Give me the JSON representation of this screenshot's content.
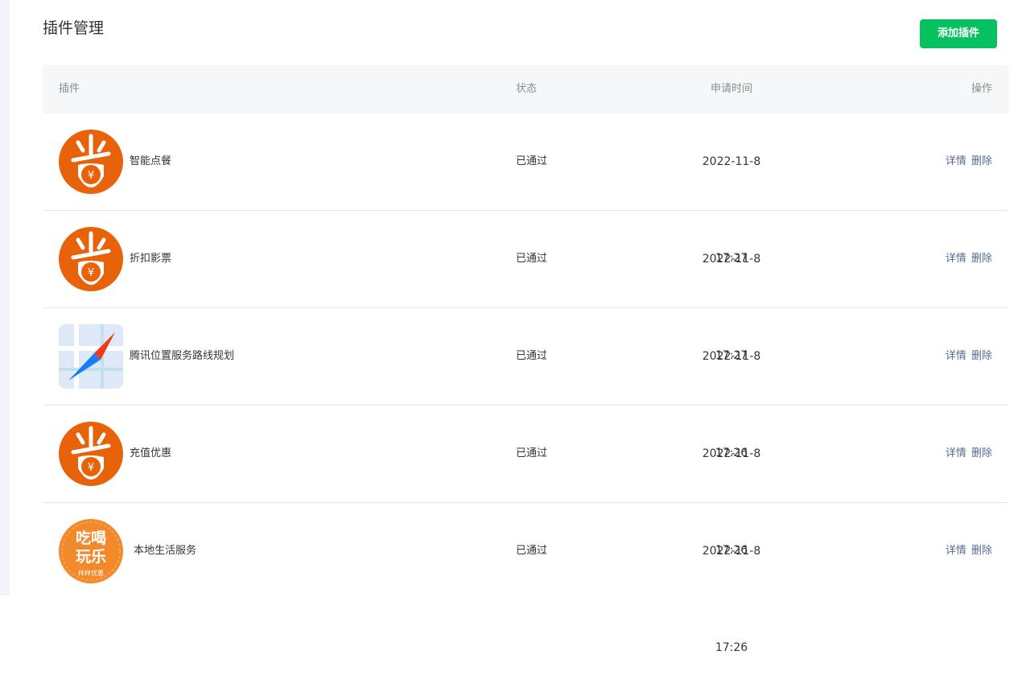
{
  "header": {
    "title": "插件管理",
    "add_button_label": "添加插件"
  },
  "table": {
    "columns": [
      "插件",
      "状态",
      "申请时间",
      "操作"
    ],
    "rows": [
      {
        "name": "智能点餐",
        "status": "已通过",
        "time": "2022-11-8 17:27",
        "logo": "sheng-logo-icon",
        "detail_label": "详情",
        "delete_label": "删除"
      },
      {
        "name": "折扣影票",
        "status": "已通过",
        "time": "2022-11-8 17:27",
        "logo": "sheng-logo-icon",
        "detail_label": "详情",
        "delete_label": "删除"
      },
      {
        "name": "腾讯位置服务路线规划",
        "status": "已通过",
        "time": "2022-11-8 17:26",
        "logo": "map-compass-icon",
        "detail_label": "详情",
        "delete_label": "删除"
      },
      {
        "name": "充值优惠",
        "status": "已通过",
        "time": "2022-11-8 17:26",
        "logo": "sheng-logo-icon",
        "detail_label": "详情",
        "delete_label": "删除"
      },
      {
        "name": "本地生活服务",
        "status": "已通过",
        "time": "2022-11-8 17:26",
        "logo": "chihe-wanle-logo-icon",
        "detail_label": "详情",
        "delete_label": "删除",
        "logo_text_top": "吃喝",
        "logo_text_bottom": "玩乐",
        "logo_text_ring": "样样优惠"
      }
    ]
  },
  "colors": {
    "accent_green": "#07c160",
    "link_blue": "#576b95",
    "logo_orange": "#e8620a",
    "logo_orange_light": "#f28a2c"
  }
}
